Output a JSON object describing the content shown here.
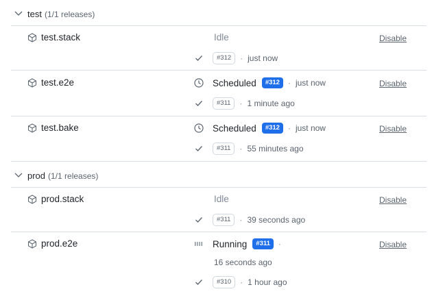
{
  "groups": [
    {
      "name": "test",
      "count": "(1/1 releases)",
      "stages": [
        {
          "name": "test.stack",
          "state": "Idle",
          "previous": {
            "badge": "#312",
            "time": "just now"
          },
          "action": "Disable"
        },
        {
          "name": "test.e2e",
          "state": "Scheduled",
          "current": {
            "badge": "#312",
            "time": "just now"
          },
          "previous": {
            "badge": "#311",
            "time": "1 minute ago"
          },
          "action": "Disable"
        },
        {
          "name": "test.bake",
          "state": "Scheduled",
          "current": {
            "badge": "#312",
            "time": "just now"
          },
          "previous": {
            "badge": "#311",
            "time": "55 minutes ago"
          },
          "action": "Disable"
        }
      ]
    },
    {
      "name": "prod",
      "count": "(1/1 releases)",
      "stages": [
        {
          "name": "prod.stack",
          "state": "Idle",
          "previous": {
            "badge": "#311",
            "time": "39 seconds ago"
          },
          "action": "Disable"
        },
        {
          "name": "prod.e2e",
          "state": "Running",
          "current": {
            "badge": "#311",
            "time": "16 seconds ago"
          },
          "previous": {
            "badge": "#310",
            "time": "1 hour ago"
          },
          "action": "Disable"
        }
      ]
    }
  ],
  "separator": "·",
  "icons": {
    "group_toggle": "chevron-down-icon",
    "stage": "package-icon",
    "done": "check-icon",
    "scheduled": "clock-icon",
    "running": "running-bars-icon"
  },
  "colors": {
    "accent": "#1f6feb",
    "text": "#1f2328",
    "muted": "#59636e",
    "border": "#d8dee4"
  }
}
